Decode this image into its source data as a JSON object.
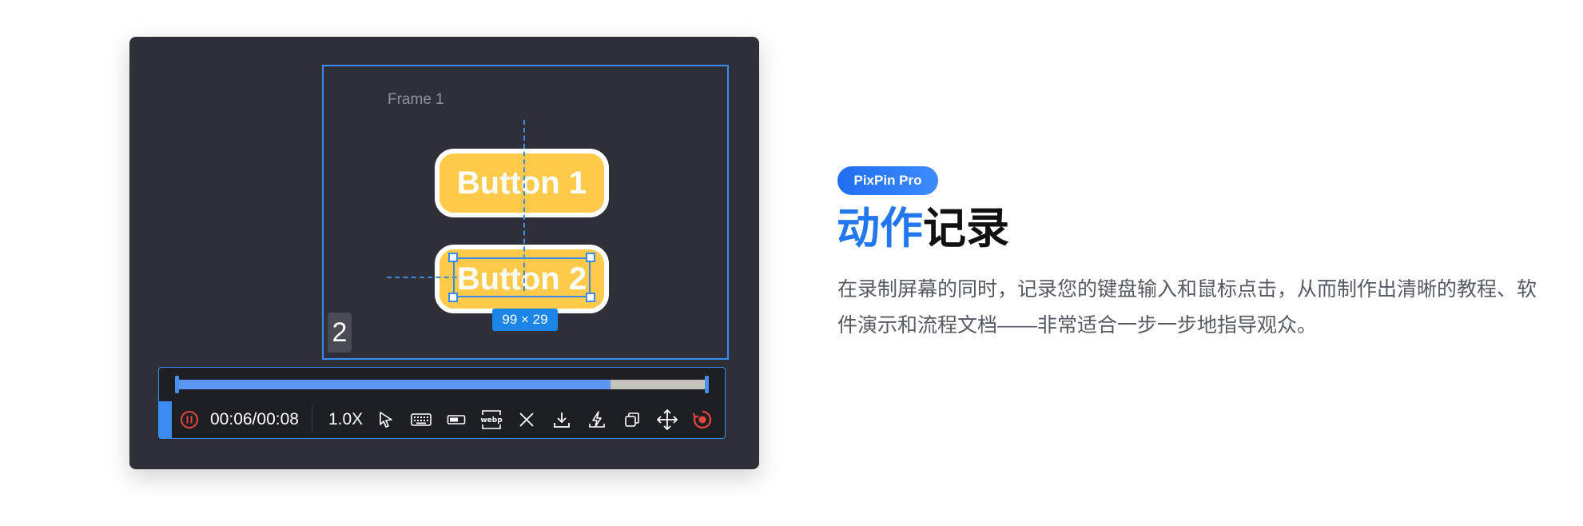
{
  "canvas": {
    "frame_label": "Frame 1",
    "button1_label": "Button 1",
    "button2_label": "Button 2",
    "selection_size": "99 × 29",
    "step_number": "2"
  },
  "recorder": {
    "progress_fraction": 0.82,
    "time": "00:06/00:08",
    "speed": "1.0X",
    "icons": [
      "pause-icon",
      "cursor-icon",
      "keyboard-icon",
      "status-bar-icon",
      "webp-icon",
      "close-icon",
      "download-icon",
      "flash-icon",
      "copy-icon",
      "move-icon",
      "record-icon"
    ]
  },
  "colors": {
    "accent": "#2277ee",
    "record_red": "#e8463a",
    "button_yellow": "#ffc94a",
    "progress_fill": "#5b96f5"
  },
  "feature": {
    "badge": "PixPin Pro",
    "title_accent": "动作",
    "title_rest": "记录",
    "description": "在录制屏幕的同时，记录您的键盘输入和鼠标点击，从而制作出清晰的教程、软件演示和流程文档——非常适合一步一步地指导观众。"
  }
}
